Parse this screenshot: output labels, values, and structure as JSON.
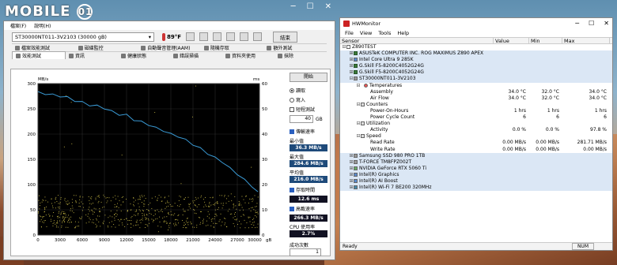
{
  "watermark": {
    "text": "MOBILE",
    "badge": "01"
  },
  "hdtune": {
    "menu": [
      "檔案(F)",
      "說明(H)"
    ],
    "drive": "ST30000NT011-3V2103 (30000 gB)",
    "temperature": "89°F",
    "exit_label": "結束",
    "tabs_top": [
      "檔案效能測試",
      "磁碟監控",
      "自動聲音管理(AAM)",
      "隨機存取",
      "額外測試"
    ],
    "tabs_bottom": [
      "效能測試",
      "資訊",
      "健康狀態",
      "錯誤掃描",
      "資料夾使用",
      "抹除"
    ],
    "side": {
      "start_label": "開始",
      "read_label": "讀取",
      "write_label": "寫入",
      "short_stroke_label": "短程測試",
      "short_stroke_value": "40",
      "short_stroke_unit": "GB",
      "transfer_label": "傳輸速率",
      "min_label": "最小值",
      "min_value": "36.3 MB/s",
      "max_label": "最大值",
      "max_value": "284.6 MB/s",
      "avg_label": "平均值",
      "avg_value": "216.0 MB/s",
      "access_label": "存取時間",
      "access_value": "12.6 ms",
      "burst_label": "高載速率",
      "burst_value": "266.3 MB/s",
      "cpu_label": "CPU 使用率",
      "cpu_value": "2.7%",
      "passes_label": "成功次數",
      "passes_value": "1"
    }
  },
  "chart_data": {
    "type": "line",
    "xlabel": "gB",
    "ylabel_left": "MB/s",
    "ylabel_right": "ms",
    "xlim": [
      0,
      30000
    ],
    "ylim_left": [
      0,
      300
    ],
    "ylim_right": [
      0,
      60
    ],
    "x_ticks": [
      "0",
      "3000",
      "6000",
      "9000",
      "12000",
      "15000",
      "18000",
      "21000",
      "24000",
      "27000",
      "30000"
    ],
    "y_left_ticks": [
      "0",
      "50",
      "100",
      "150",
      "200",
      "250",
      "300"
    ],
    "y_right_ticks": [
      "0",
      "10",
      "20",
      "30",
      "40",
      "50",
      "60"
    ],
    "series": [
      {
        "name": "",
        "color": "#3a9bd6",
        "x": [
          0,
          1000,
          2000,
          3000,
          4000,
          5000,
          6000,
          7000,
          8000,
          9000,
          10000,
          11000,
          12000,
          13000,
          14000,
          15000,
          16000,
          17000,
          18000,
          19000,
          20000,
          21000,
          22000,
          23000,
          24000,
          25000,
          26000,
          27000,
          28000,
          29000,
          29800
        ],
        "values": [
          284,
          281,
          279,
          276,
          272,
          268,
          264,
          258,
          255,
          250,
          246,
          240,
          236,
          229,
          224,
          220,
          212,
          207,
          200,
          194,
          186,
          178,
          170,
          162,
          154,
          144,
          132,
          120,
          108,
          96,
          84
        ]
      }
    ],
    "scatter_band_ms": [
      3,
      16
    ],
    "grid": true
  },
  "hwmonitor": {
    "title": "HWMonitor",
    "menu": [
      "File",
      "View",
      "Tools",
      "Help"
    ],
    "columns": [
      "Sensor",
      "Value",
      "Min",
      "Max"
    ],
    "rows": [
      {
        "indent": 0,
        "icon": "pc",
        "label": "Z890TEST",
        "v": "",
        "min": "",
        "max": "",
        "hl": false
      },
      {
        "indent": 1,
        "icon": "chip",
        "label": "ASUSTeK COMPUTER INC. ROG MAXIMUS Z890 APEX",
        "v": "",
        "min": "",
        "max": "",
        "hl": true
      },
      {
        "indent": 1,
        "icon": "cpu",
        "label": "Intel Core Ultra 9 285K",
        "v": "",
        "min": "",
        "max": "",
        "hl": true
      },
      {
        "indent": 1,
        "icon": "chip",
        "label": "G.Skill F5-8200C4052G24G",
        "v": "",
        "min": "",
        "max": "",
        "hl": true
      },
      {
        "indent": 1,
        "icon": "chip",
        "label": "G.Skill F5-8200C4052G24G",
        "v": "",
        "min": "",
        "max": "",
        "hl": true
      },
      {
        "indent": 1,
        "icon": "disk",
        "label": "ST30000NT011-3V2103",
        "v": "",
        "min": "",
        "max": "",
        "hl": true
      },
      {
        "indent": 2,
        "icon": "temp",
        "label": "Temperatures",
        "v": "",
        "min": "",
        "max": "",
        "hl": false
      },
      {
        "indent": 4,
        "icon": "",
        "label": "Assembly",
        "v": "34.0 °C",
        "min": "32.0 °C",
        "max": "34.0 °C",
        "hl": false
      },
      {
        "indent": 4,
        "icon": "",
        "label": "Air Flow",
        "v": "34.0 °C",
        "min": "32.0 °C",
        "max": "34.0 °C",
        "hl": false
      },
      {
        "indent": 2,
        "icon": "grp",
        "label": "Counters",
        "v": "",
        "min": "",
        "max": "",
        "hl": false
      },
      {
        "indent": 4,
        "icon": "",
        "label": "Power-On-Hours",
        "v": "1 hrs",
        "min": "1 hrs",
        "max": "1 hrs",
        "hl": false
      },
      {
        "indent": 4,
        "icon": "",
        "label": "Power Cycle Count",
        "v": "6",
        "min": "6",
        "max": "6",
        "hl": false
      },
      {
        "indent": 2,
        "icon": "grp",
        "label": "Utilization",
        "v": "",
        "min": "",
        "max": "",
        "hl": false
      },
      {
        "indent": 4,
        "icon": "",
        "label": "Activity",
        "v": "0.0 %",
        "min": "0.0 %",
        "max": "97.8 %",
        "hl": false
      },
      {
        "indent": 2,
        "icon": "grp",
        "label": "Speed",
        "v": "",
        "min": "",
        "max": "",
        "hl": false
      },
      {
        "indent": 4,
        "icon": "",
        "label": "Read Rate",
        "v": "0.00 MB/s",
        "min": "0.00 MB/s",
        "max": "281.71 MB/s",
        "hl": false
      },
      {
        "indent": 4,
        "icon": "",
        "label": "Write Rate",
        "v": "0.00 MB/s",
        "min": "0.00 MB/s",
        "max": "0.00 MB/s",
        "hl": false
      },
      {
        "indent": 1,
        "icon": "disk",
        "label": "Samsung SSD 980 PRO 1TB",
        "v": "",
        "min": "",
        "max": "",
        "hl": true
      },
      {
        "indent": 1,
        "icon": "disk",
        "label": "T-FORCE TM8FPZ002T",
        "v": "",
        "min": "",
        "max": "",
        "hl": true
      },
      {
        "indent": 1,
        "icon": "gpu",
        "label": "NVIDIA GeForce RTX 5060 Ti",
        "v": "",
        "min": "",
        "max": "",
        "hl": true
      },
      {
        "indent": 1,
        "icon": "cpu",
        "label": "Intel(R) Graphics",
        "v": "",
        "min": "",
        "max": "",
        "hl": true
      },
      {
        "indent": 1,
        "icon": "cpu",
        "label": "Intel(R) AI Boost",
        "v": "",
        "min": "",
        "max": "",
        "hl": true
      },
      {
        "indent": 1,
        "icon": "net",
        "label": "Intel(R) Wi-Fi 7 BE200 320MHz",
        "v": "",
        "min": "",
        "max": "",
        "hl": true
      }
    ],
    "status": "Ready",
    "num_indicator": "NUM"
  }
}
